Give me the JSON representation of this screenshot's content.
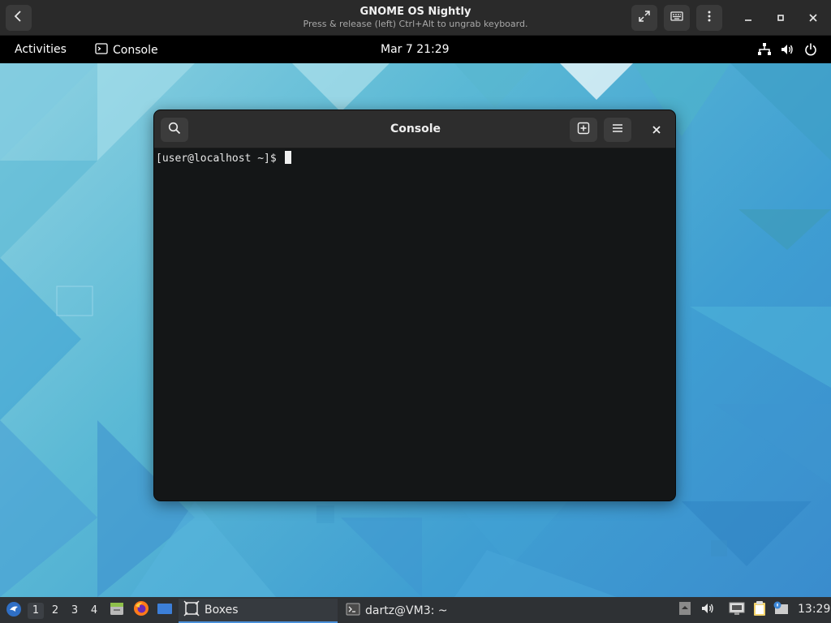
{
  "boxes_header": {
    "title": "GNOME OS Nightly",
    "subtitle": "Press & release (left) Ctrl+Alt to ungrab keyboard.",
    "icons": [
      "back-icon",
      "fullscreen-icon",
      "keyboard-icon",
      "menu-icon",
      "minimize-icon",
      "maximize-icon",
      "close-icon"
    ]
  },
  "gnome_top_bar": {
    "activities": "Activities",
    "app_name": "Console",
    "clock": "Mar 7  21:29",
    "status_icons": [
      "network-icon",
      "volume-icon",
      "power-icon"
    ]
  },
  "console_window": {
    "title": "Console",
    "prompt": "[user@localhost ~]$ ",
    "icons": [
      "search-icon",
      "new-tab-icon",
      "hamburger-menu-icon",
      "close-icon"
    ]
  },
  "taskbar": {
    "workspaces": [
      "1",
      "2",
      "3",
      "4"
    ],
    "active_workspace": "1",
    "tasks": [
      {
        "label": "Boxes",
        "icon": "boxes-icon",
        "active": true
      },
      {
        "label": "dartz@VM3: ~",
        "icon": "terminal-icon",
        "active": false
      }
    ],
    "clock": "13:29",
    "launchers": [
      "start-menu-icon",
      "file-manager-icon",
      "firefox-icon",
      "show-desktop-icon"
    ]
  },
  "colors": {
    "accent": "#4a90d9",
    "terminal_bg": "#141617",
    "header_bg": "#2a2a2a"
  }
}
